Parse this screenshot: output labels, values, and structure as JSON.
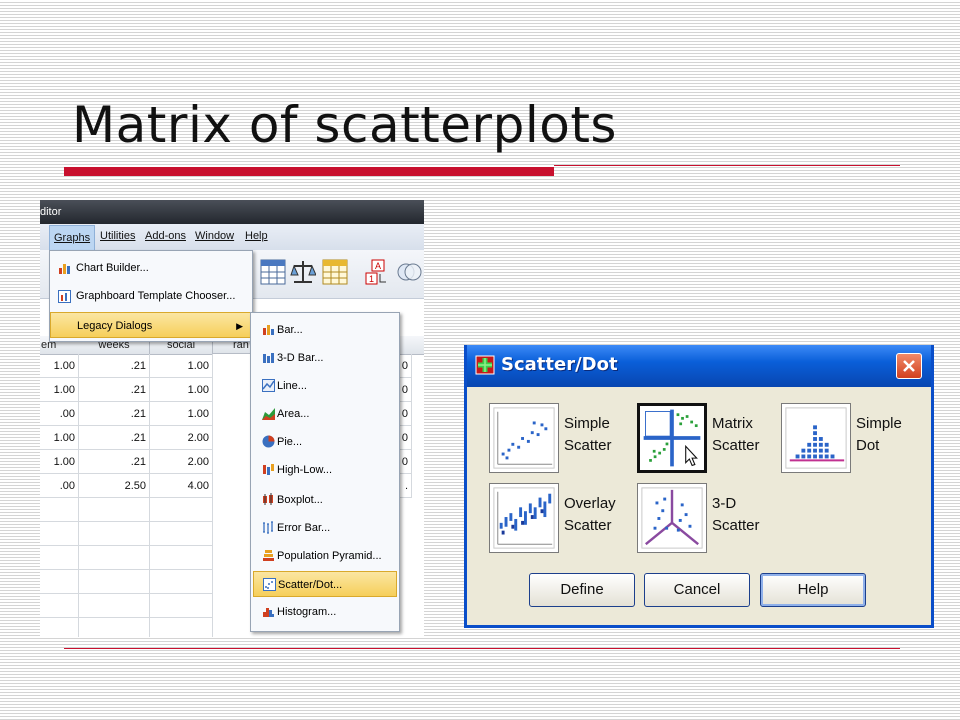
{
  "slide": {
    "title": "Matrix of scatterplots"
  },
  "spss": {
    "window_title_fragment": "ditor",
    "menubar": [
      "Graphs",
      "Utilities",
      "Add-ons",
      "Window",
      "Help"
    ],
    "graphs_menu": [
      "Chart Builder...",
      "Graphboard Template Chooser...",
      "Legacy Dialogs"
    ],
    "legacy_menu": [
      "Bar...",
      "3-D Bar...",
      "Line...",
      "Area...",
      "Pie...",
      "High-Low...",
      "Boxplot...",
      "Error Bar...",
      "Population Pyramid...",
      "Scatter/Dot...",
      "Histogram..."
    ],
    "columns": [
      "em",
      "weeks",
      "social",
      "ran"
    ],
    "rows": [
      [
        "1.00",
        ".21",
        "1.00",
        "0"
      ],
      [
        "1.00",
        ".21",
        "1.00",
        "0"
      ],
      [
        ".00",
        ".21",
        "1.00",
        "0"
      ],
      [
        "1.00",
        ".21",
        "2.00",
        "0"
      ],
      [
        "1.00",
        ".21",
        "2.00",
        "0"
      ],
      [
        ".00",
        "2.50",
        "4.00",
        "."
      ]
    ]
  },
  "dialog": {
    "title": "Scatter/Dot",
    "options": [
      {
        "label_line1": "Simple",
        "label_line2": "Scatter"
      },
      {
        "label_line1": "Matrix",
        "label_line2": "Scatter"
      },
      {
        "label_line1": "Simple",
        "label_line2": "Dot"
      },
      {
        "label_line1": "Overlay",
        "label_line2": "Scatter"
      },
      {
        "label_line1": "3-D",
        "label_line2": "Scatter"
      }
    ],
    "buttons": {
      "define": "Define",
      "cancel": "Cancel",
      "help": "Help"
    }
  },
  "colors": {
    "accent_red": "#c8102e",
    "dialog_blue": "#0a5fd9",
    "highlight": "#f6cf5a"
  }
}
